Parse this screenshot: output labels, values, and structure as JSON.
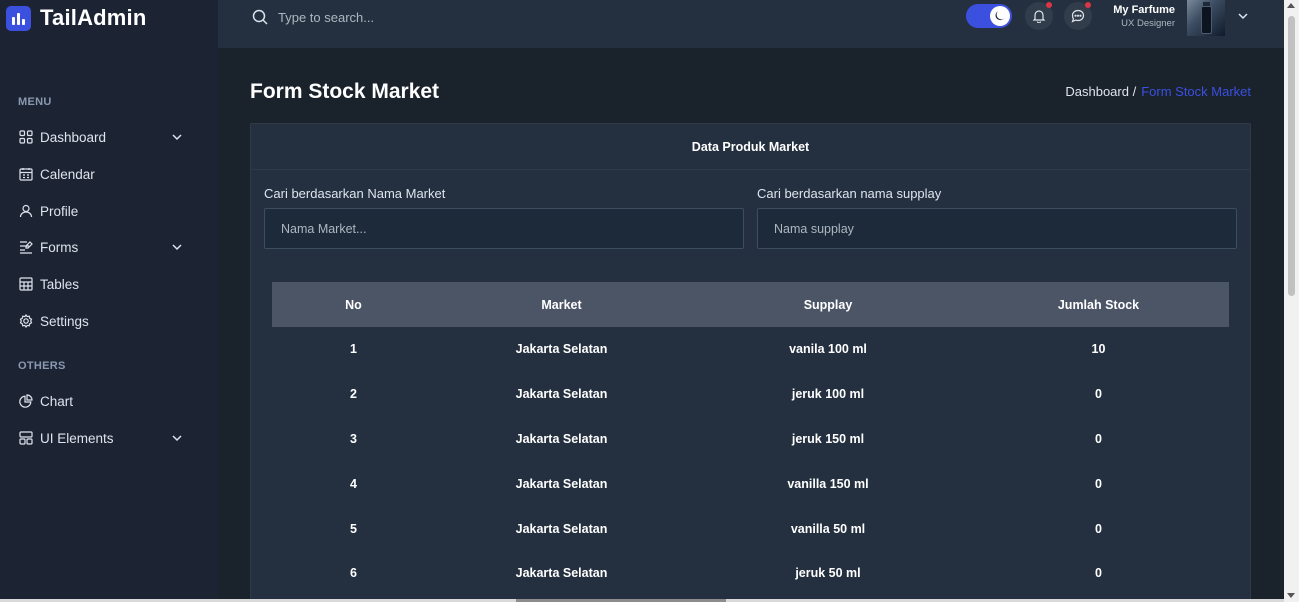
{
  "app": {
    "name": "TailAdmin",
    "accent": "#3c50e0"
  },
  "search": {
    "placeholder": "Type to search..."
  },
  "header": {
    "dark_mode": true,
    "notification_icon": "bell-icon",
    "message_icon": "chat-icon",
    "user": {
      "name": "My Farfume",
      "role": "UX Designer"
    }
  },
  "sidebar": {
    "menu_label": "MENU",
    "menu_items": [
      {
        "label": "Dashboard",
        "icon": "grid-icon",
        "has_submenu": true
      },
      {
        "label": "Calendar",
        "icon": "calendar-icon",
        "has_submenu": false
      },
      {
        "label": "Profile",
        "icon": "user-icon",
        "has_submenu": false
      },
      {
        "label": "Forms",
        "icon": "forms-icon",
        "has_submenu": true
      },
      {
        "label": "Tables",
        "icon": "table-icon",
        "has_submenu": false
      },
      {
        "label": "Settings",
        "icon": "gear-icon",
        "has_submenu": false
      }
    ],
    "others_label": "OTHERS",
    "other_items": [
      {
        "label": "Chart",
        "icon": "pie-chart-icon",
        "has_submenu": false
      },
      {
        "label": "UI Elements",
        "icon": "layout-icon",
        "has_submenu": true
      }
    ]
  },
  "page": {
    "title": "Form Stock Market",
    "breadcrumb": {
      "parent": "Dashboard /",
      "current": "Form Stock Market"
    }
  },
  "card": {
    "title": "Data Produk Market",
    "filters": {
      "market_label": "Cari berdasarkan Nama Market",
      "market_placeholder": "Nama Market...",
      "supply_label": "Cari berdasarkan nama supplay",
      "supply_placeholder": "Nama supplay"
    },
    "table": {
      "headers": [
        "No",
        "Market",
        "Supplay",
        "Jumlah Stock"
      ],
      "rows": [
        [
          "1",
          "Jakarta Selatan",
          "vanila 100 ml",
          "10"
        ],
        [
          "2",
          "Jakarta Selatan",
          "jeruk 100 ml",
          "0"
        ],
        [
          "3",
          "Jakarta Selatan",
          "jeruk 150 ml",
          "0"
        ],
        [
          "4",
          "Jakarta Selatan",
          "vanilla 150 ml",
          "0"
        ],
        [
          "5",
          "Jakarta Selatan",
          "vanilla 50 ml",
          "0"
        ],
        [
          "6",
          "Jakarta Selatan",
          "jeruk 50 ml",
          "0"
        ]
      ]
    }
  }
}
